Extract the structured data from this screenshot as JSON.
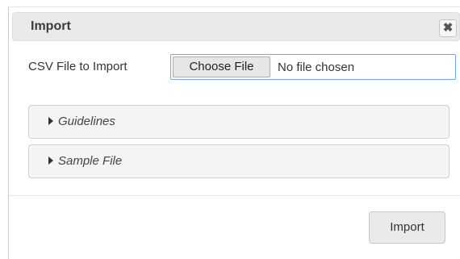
{
  "dialog": {
    "title": "Import",
    "close_icon": "close-icon",
    "close_glyph": "✖"
  },
  "file_picker": {
    "label": "CSV File to Import",
    "button_label": "Choose File",
    "status": "No file chosen"
  },
  "sections": [
    {
      "label": "Guidelines",
      "expanded": false
    },
    {
      "label": "Sample File",
      "expanded": false
    }
  ],
  "footer": {
    "import_label": "Import"
  },
  "colors": {
    "titlebar_bg": "#eaeaea",
    "input_focus_border": "#7aa7d8",
    "section_bg": "#f4f4f4"
  }
}
